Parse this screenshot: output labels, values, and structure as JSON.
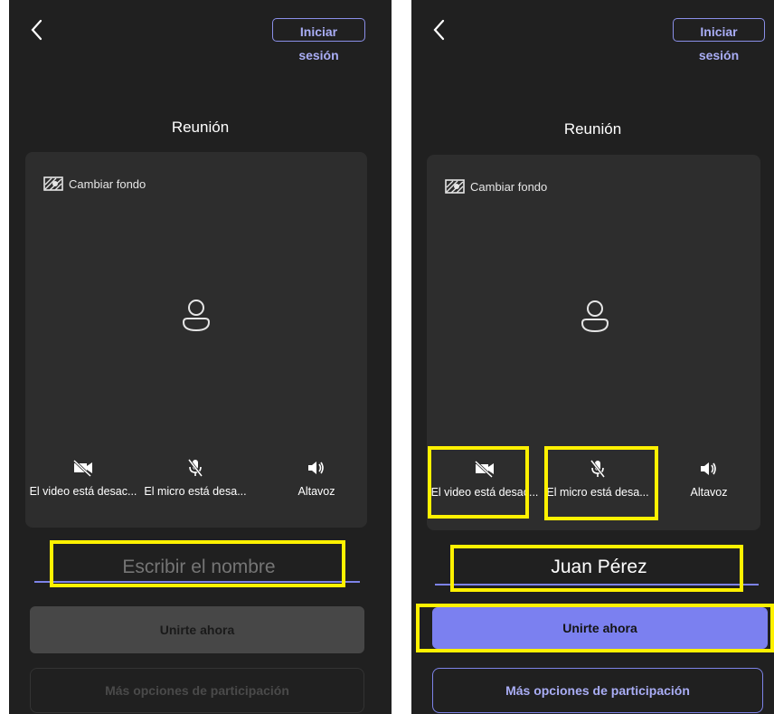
{
  "left": {
    "signin_label": "Iniciar sesión",
    "title": "Reunión",
    "change_bg_label": "Cambiar fondo",
    "video_label": "El video está desac...",
    "mic_label": "El micro está desa...",
    "speaker_label": "Altavoz",
    "name_placeholder": "Escribir el nombre",
    "join_label": "Unirte ahora",
    "more_label": "Más opciones de participación"
  },
  "right": {
    "signin_label": "Iniciar sesión",
    "title": "Reunión",
    "change_bg_label": "Cambiar fondo",
    "video_label": "El video está desac...",
    "mic_label": "El micro está desa...",
    "speaker_label": "Altavoz",
    "name_value": "Juan Pérez",
    "join_label": "Unirte ahora",
    "more_label": "Más opciones de participación"
  },
  "colors": {
    "background": "#202020",
    "panel": "#2d2d2d",
    "accent": "#7b80f0",
    "highlight": "#fff100",
    "join_disabled": "#474747"
  },
  "icons": [
    "back-chevron-icon",
    "change-background-icon",
    "person-avatar-icon",
    "video-off-icon",
    "mic-off-icon",
    "speaker-icon"
  ]
}
